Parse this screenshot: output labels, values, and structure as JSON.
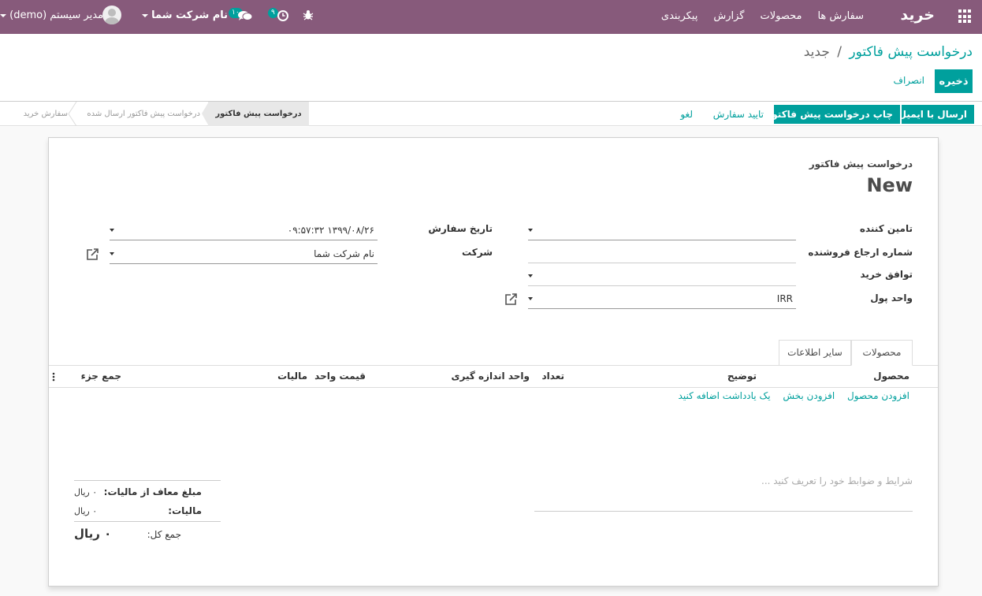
{
  "navbar": {
    "app_name": "خرید",
    "menu": [
      "سفارش ها",
      "محصولات",
      "گزارش",
      "پیکربندی"
    ],
    "user_label": "مدیر سیستم (demo)",
    "company_label": "نام شرکت شما",
    "messages_count": "۱۰",
    "activities_count": "۹"
  },
  "breadcrumb": {
    "parent": "درخواست پیش فاکتور",
    "separator": "/",
    "current": "جدید"
  },
  "actions": {
    "save": "ذخیره",
    "discard": "انصراف"
  },
  "statusbar": {
    "buttons": {
      "send_email": "ارسال با ایمیل",
      "print_rfq": "چاپ درخواست پیش فاکتور",
      "confirm": "تایید سفارش",
      "cancel": "لغو"
    },
    "stages": {
      "rfq": "درخواست پیش فاکتور",
      "rfq_sent": "درخواست پیش فاکتور ارسال شده",
      "purchase_order": "سفارش خرید"
    }
  },
  "form": {
    "doc_label": "درخواست پیش فاکتور",
    "doc_name": "New",
    "fields": {
      "vendor_label": "تامین کننده",
      "vendor_value": "",
      "vendor_ref_label": "شماره ارجاع فروشنده",
      "vendor_ref_value": "",
      "agreement_label": "توافق خرید",
      "agreement_value": "",
      "currency_label": "واحد پول",
      "currency_value": "IRR",
      "order_date_label": "تاریخ سفارش",
      "order_date_value": "۱۳۹۹/۰۸/۲۶ ۰۹:۵۷:۳۲",
      "company_label": "شرکت",
      "company_value": "نام شرکت شما"
    },
    "tabs": [
      "محصولات",
      "سایر اطلاعات"
    ],
    "table": {
      "columns": [
        "محصول",
        "توضیح",
        "تعداد",
        "واحد اندازه گیری",
        "قیمت واحد",
        "مالیات",
        "جمع جزء"
      ],
      "add_product": "افزودن محصول",
      "add_section": "افزودن بخش",
      "add_note": "یک یادداشت اضافه کنید"
    },
    "notes_placeholder": "شرایط و ضوابط خود را تعریف کنید ...",
    "totals": {
      "untaxed_label": "مبلغ معاف از مالیات:",
      "untaxed_value": "۰ ریال",
      "tax_label": "مالیات:",
      "tax_value": "۰ ریال",
      "total_label": "جمع کل:",
      "total_value": "۰ ریال"
    }
  }
}
